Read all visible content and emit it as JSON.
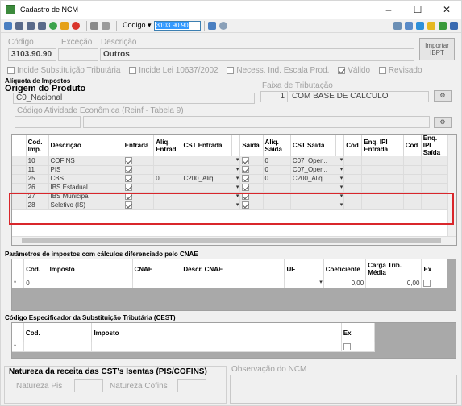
{
  "window": {
    "title": "Cadastro de NCM",
    "min": "–",
    "max": "☐",
    "close": "✕"
  },
  "toolbar": {
    "codigo_label": "Codigo ▾",
    "codigo_value": "3103.90.90"
  },
  "header": {
    "codigo_label": "Código",
    "excecao_label": "Exceção",
    "descricao_label": "Descrição",
    "codigo_value": "3103.90.90",
    "descricao_value": "Outros",
    "importar_label": "Importar IBPT"
  },
  "options": {
    "incide_st": "Incide Substituição Tributária",
    "incide_lei": "Incide Lei 10637/2002",
    "necess": "Necess. Ind. Escala Prod.",
    "valido": "Válido",
    "revisado": "Revisado"
  },
  "aliquota": {
    "title": "Alíquota de Impostos",
    "origem_label": "Origem do Produto",
    "origem_value": "C0_Nacional",
    "faixa_label": "Faixa de Tributação",
    "faixa_num": "1",
    "faixa_value": "COM BASE DE CALCULO",
    "cod_atividade_label": "Código Atividade Econômica (Reinf - Tabela 9)"
  },
  "imp_table": {
    "headers": [
      "Cod. Imp.",
      "Descrição",
      "Entrada",
      "Alíq. Entrad",
      "CST Entrada",
      "",
      "Saída",
      "Alíq. Saída",
      "CST Saída",
      "",
      "Cod",
      "Enq. IPI Entrada",
      "Cod",
      "Enq. IPI Saída"
    ],
    "rows": [
      {
        "cod": "10",
        "desc": "COFINS",
        "ent_chk": true,
        "aliq_e": "",
        "cst_e": "",
        "sai_chk": true,
        "aliq_s": "0",
        "cst_s": "C07_Oper..."
      },
      {
        "cod": "11",
        "desc": "PIS",
        "ent_chk": true,
        "aliq_e": "",
        "cst_e": "",
        "sai_chk": true,
        "aliq_s": "0",
        "cst_s": "C07_Oper..."
      },
      {
        "cod": "25",
        "desc": "CBS",
        "ent_chk": true,
        "aliq_e": "0",
        "cst_e": "C200_Aliq...",
        "sai_chk": true,
        "aliq_s": "0",
        "cst_s": "C200_Aliq..."
      },
      {
        "cod": "26",
        "desc": "IBS Estadual",
        "ent_chk": true,
        "aliq_e": "",
        "cst_e": "",
        "sai_chk": true,
        "aliq_s": "",
        "cst_s": ""
      },
      {
        "cod": "27",
        "desc": "IBS Municipal",
        "ent_chk": true,
        "aliq_e": "",
        "cst_e": "",
        "sai_chk": true,
        "aliq_s": "",
        "cst_s": ""
      },
      {
        "cod": "28",
        "desc": "Seletivo (IS)",
        "ent_chk": true,
        "aliq_e": "",
        "cst_e": "",
        "sai_chk": true,
        "aliq_s": "",
        "cst_s": ""
      }
    ]
  },
  "cnae": {
    "title": "Parâmetros de impostos com cálculos diferenciado pelo CNAE",
    "headers": [
      "Cod.",
      "Imposto",
      "CNAE",
      "Descr. CNAE",
      "UF",
      "Coeficiente",
      "Carga Trib. Média",
      "Ex"
    ],
    "row": {
      "marker": "*",
      "cod": "0",
      "coef": "0,00",
      "carga": "0,00"
    }
  },
  "cest": {
    "title": "Código Especificador da Substituição Tributária (CEST)",
    "headers": [
      "Cod.",
      "Imposto",
      "Ex"
    ],
    "marker": "*"
  },
  "natureza": {
    "title": "Natureza da receita das CST's Isentas (PIS/COFINS)",
    "pis_label": "Natureza Pis",
    "cofins_label": "Natureza Cofins"
  },
  "observacao": {
    "label": "Observação do NCM"
  },
  "colors": {
    "highlight": "#d9262b",
    "selection": "#3399ff"
  }
}
